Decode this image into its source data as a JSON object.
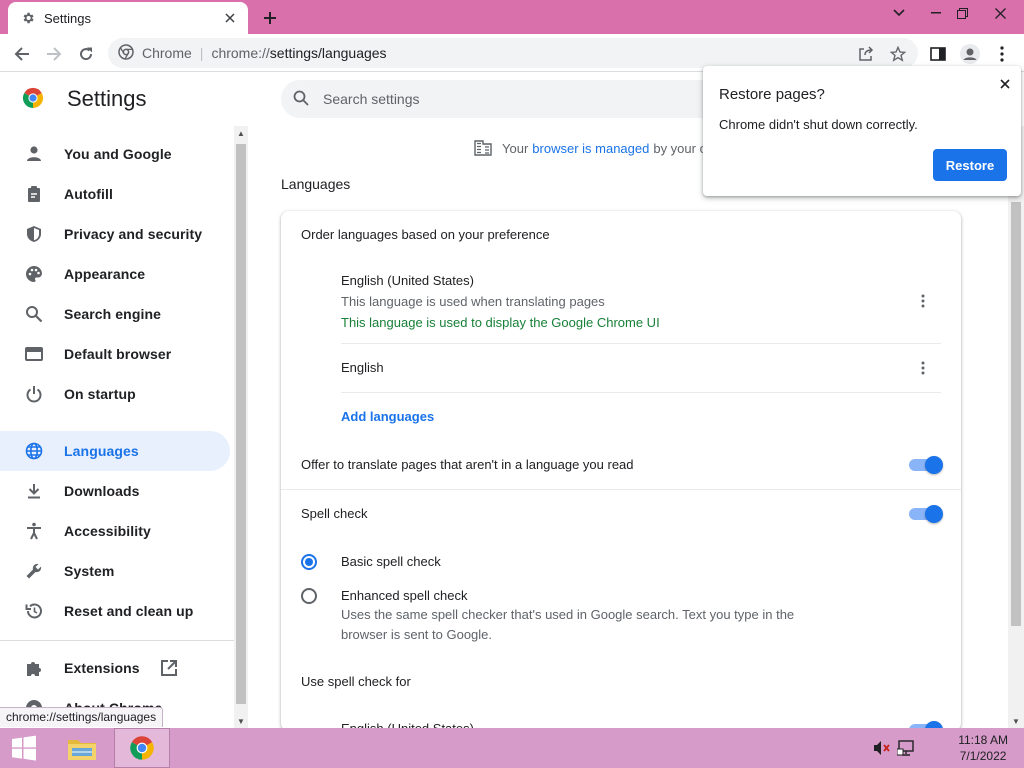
{
  "browser": {
    "tab_title": "Settings",
    "omnibox": {
      "site": "Chrome",
      "url_prefix": "chrome://",
      "url_path": "settings/languages"
    }
  },
  "header": {
    "title": "Settings",
    "search_placeholder": "Search settings"
  },
  "sidebar": {
    "items": [
      {
        "label": "You and Google",
        "icon": "person-icon"
      },
      {
        "label": "Autofill",
        "icon": "clipboard-icon"
      },
      {
        "label": "Privacy and security",
        "icon": "shield-icon"
      },
      {
        "label": "Appearance",
        "icon": "palette-icon"
      },
      {
        "label": "Search engine",
        "icon": "search-icon"
      },
      {
        "label": "Default browser",
        "icon": "browser-window-icon"
      },
      {
        "label": "On startup",
        "icon": "power-icon"
      },
      {
        "label": "Languages",
        "icon": "globe-icon",
        "active": true
      },
      {
        "label": "Downloads",
        "icon": "download-icon"
      },
      {
        "label": "Accessibility",
        "icon": "accessibility-icon"
      },
      {
        "label": "System",
        "icon": "wrench-icon"
      },
      {
        "label": "Reset and clean up",
        "icon": "restore-icon"
      },
      {
        "label": "Extensions",
        "icon": "puzzle-icon"
      },
      {
        "label": "About Chrome",
        "icon": "chrome-icon"
      }
    ]
  },
  "main": {
    "managed_prefix": "Your",
    "managed_link": "browser is managed",
    "managed_suffix": "by your o",
    "section_title": "Languages",
    "order_label": "Order languages based on your preference",
    "languages": [
      {
        "name": "English (United States)",
        "sub1": "This language is used when translating pages",
        "sub2": "This language is used to display the Google Chrome UI"
      },
      {
        "name": "English"
      }
    ],
    "add_languages": "Add languages",
    "offer_translate": "Offer to translate pages that aren't in a language you read",
    "spell_check": "Spell check",
    "basic_spell": "Basic spell check",
    "enhanced_spell": "Enhanced spell check",
    "enhanced_desc": "Uses the same spell checker that's used in Google search. Text you type in the browser is sent to Google.",
    "use_spell_for": "Use spell check for",
    "spell_lang_partial": "English (United States)"
  },
  "popup": {
    "title": "Restore pages?",
    "body": "Chrome didn't shut down correctly.",
    "button": "Restore"
  },
  "status_bubble": "chrome://settings/languages",
  "taskbar": {
    "time": "11:18 AM",
    "date": "7/1/2022"
  },
  "colors": {
    "tabstrip": "#d96fab",
    "taskbar": "#d69bc8",
    "accent": "#1a73e8",
    "green": "#188038"
  }
}
